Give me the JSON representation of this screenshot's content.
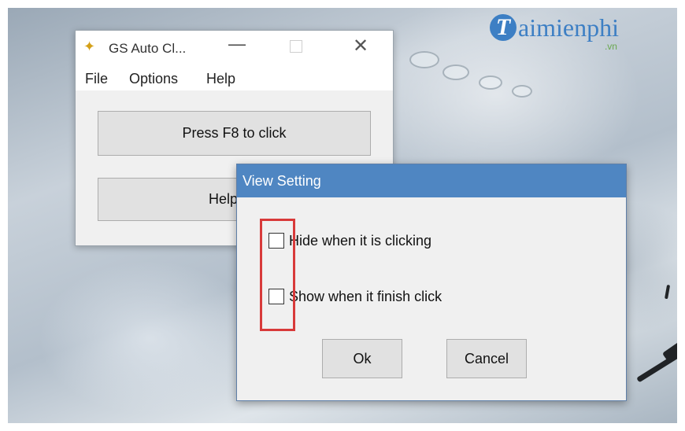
{
  "watermark": {
    "brand": "aimienphi",
    "brand_initial": "T",
    "suffix": ".vn"
  },
  "main_window": {
    "title": "GS Auto Cl...",
    "controls": {
      "minimize": "—",
      "maximize": "",
      "close": "✕"
    },
    "menu": [
      "File",
      "Options",
      "Help"
    ],
    "buttons": {
      "press": "Press F8 to click",
      "help": "Help"
    }
  },
  "dialog": {
    "title": "View Setting",
    "checkboxes": [
      {
        "label": "Hide when it is clicking",
        "checked": false
      },
      {
        "label": "Show when it finish click",
        "checked": false
      }
    ],
    "ok_label": "Ok",
    "cancel_label": "Cancel"
  },
  "colors": {
    "dialog_titlebar": "#4f86c2",
    "highlight_box": "#d83a3a",
    "brand": "#3d7fc4"
  }
}
